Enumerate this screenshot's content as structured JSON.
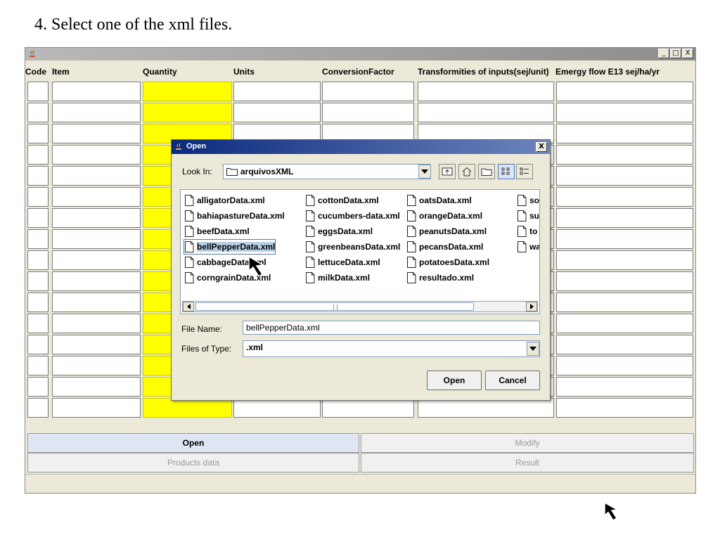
{
  "instruction": "4. Select one of the xml files.",
  "app_window": {
    "window_controls": [
      "_",
      "□",
      "X"
    ],
    "columns": [
      "Code",
      "Item",
      "Quantity",
      "Units",
      "ConversionFactor",
      "Transformities of inputs(sej/unit)",
      "Emergy flow E13 sej/ha/yr"
    ],
    "row_count": 16,
    "highlight_color": "#ffff00",
    "buttons": {
      "open": "Open",
      "modify": "Modify",
      "products_data": "Products data",
      "result": "Result"
    }
  },
  "open_dialog": {
    "title": "Open",
    "close": "X",
    "look_in_label": "Look In:",
    "look_in_value": "arquivosXML",
    "toolbar_icons": [
      "up-folder-icon",
      "home-icon",
      "new-folder-icon",
      "list-view-icon",
      "details-view-icon"
    ],
    "files": [
      "alligatorData.xml",
      "bahiapastureData.xml",
      "beefData.xml",
      "bellPepperData.xml",
      "cabbageData.xml",
      "corngrainData.xml",
      "cottonData.xml",
      "cucumbers-data.xml",
      "eggsData.xml",
      "greenbeansData.xml",
      "lettuceData.xml",
      "milkData.xml",
      "oatsData.xml",
      "orangeData.xml",
      "peanutsData.xml",
      "pecansData.xml",
      "potatoesData.xml",
      "resultado.xml",
      "so",
      "su",
      "to",
      "wa"
    ],
    "selected_file": "bellPepperData.xml",
    "file_name_label": "File Name:",
    "file_name_value": "bellPepperData.xml",
    "files_of_type_label": "Files of Type:",
    "files_of_type_value": ".xml",
    "open_button": "Open",
    "cancel_button": "Cancel"
  }
}
